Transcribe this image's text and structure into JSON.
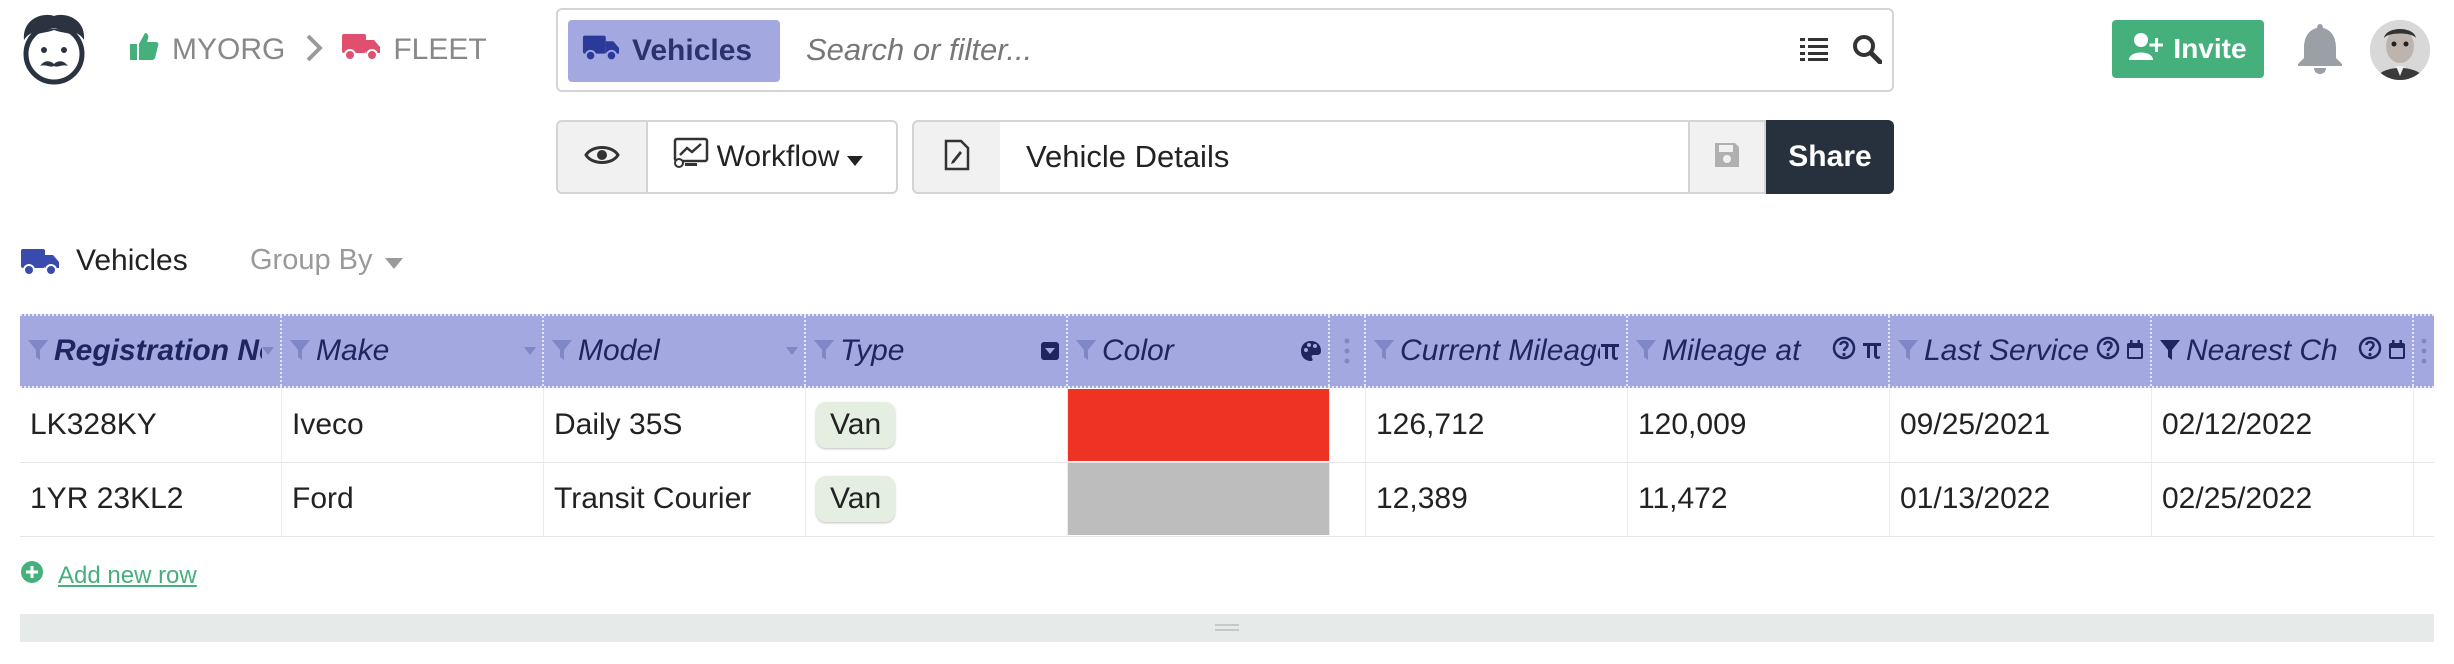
{
  "header": {
    "breadcrumb": [
      {
        "label": "MYORG",
        "icon": "thumbs-up-icon",
        "color": "#46b07c"
      },
      {
        "label": "FLEET",
        "icon": "truck-icon",
        "color": "#e0506e"
      }
    ],
    "search": {
      "tag": "Vehicles",
      "placeholder": "Search or filter..."
    },
    "invite_label": "Invite"
  },
  "toolbar": {
    "workflow_label": "Workflow",
    "view_name": "Vehicle Details",
    "share_label": "Share"
  },
  "table_header": {
    "title": "Vehicles",
    "group_by_label": "Group By"
  },
  "table": {
    "columns": [
      {
        "label": "Registration No",
        "bold": true
      },
      {
        "label": "Make"
      },
      {
        "label": "Model"
      },
      {
        "label": "Type"
      },
      {
        "label": "Color"
      },
      {
        "label": "Current Mileage"
      },
      {
        "label": "Mileage at"
      },
      {
        "label": "Last Service"
      },
      {
        "label": "Nearest Ch"
      }
    ],
    "rows": [
      {
        "registration": "LK328KY",
        "make": "Iveco",
        "model": "Daily 35S",
        "type": "Van",
        "color": "#ee3224",
        "current_mileage": "126,712",
        "mileage_at": "120,009",
        "last_service": "09/25/2021",
        "nearest": "02/12/2022"
      },
      {
        "registration": "1YR 23KL2",
        "make": "Ford",
        "model": "Transit Courier",
        "type": "Van",
        "color": "#bdbdbd",
        "current_mileage": "12,389",
        "mileage_at": "11,472",
        "last_service": "01/13/2022",
        "nearest": "02/25/2022"
      }
    ]
  },
  "add_row_label": "Add new row",
  "colors": {
    "accent_green": "#46b07c",
    "header_blue": "#a3a9e0",
    "share_dark": "#27303d"
  }
}
